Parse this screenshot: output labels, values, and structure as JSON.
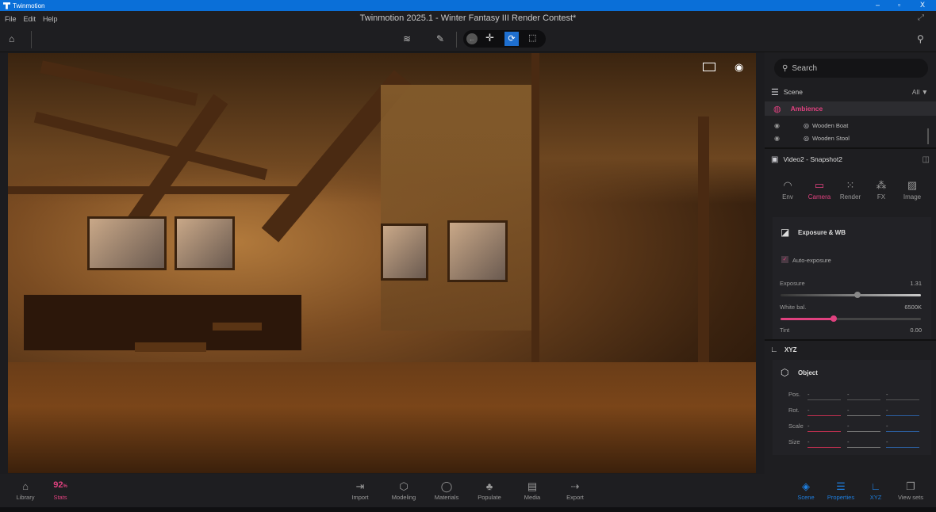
{
  "window": {
    "app_name": "Twinmotion",
    "title": "Twinmotion 2025.1 - Winter Fantasy III Render Contest*",
    "minimize": "–",
    "restore": "▫",
    "close": "X"
  },
  "menu": [
    "File",
    "Edit",
    "Help"
  ],
  "panel": {
    "search_placeholder": "Search",
    "scene_label": "Scene",
    "filter": "All",
    "ambience": "Ambience",
    "items": [
      "Wooden Boat",
      "Wooden Stool"
    ],
    "snapshot": "Video2 - Snapshot2",
    "tabs": [
      "Env",
      "Camera",
      "Render",
      "FX",
      "Image"
    ],
    "active_tab": "Camera",
    "exposure_section": "Exposure & WB",
    "auto_exposure": "Auto-exposure",
    "auto_exposure_checked": true,
    "exposure": {
      "label": "Exposure",
      "value": "1.31",
      "fraction": 0.55
    },
    "white_balance": {
      "label": "White bal.",
      "value": "6500K",
      "fraction": 0.38
    },
    "tint": {
      "label": "Tint",
      "value": "0.00"
    },
    "xyz_label": "XYZ",
    "object_label": "Object",
    "xyz_rows": [
      "Pos.",
      "Rot.",
      "Scale",
      "Size"
    ],
    "xyz_placeholder": "-"
  },
  "bottom": {
    "left": [
      {
        "label": "Library"
      },
      {
        "label": "Stats",
        "value": "92",
        "unit": "%"
      }
    ],
    "center": [
      "Import",
      "Modeling",
      "Materials",
      "Populate",
      "Media",
      "Export"
    ],
    "right": [
      "Scene",
      "Properties",
      "XYZ",
      "View sets"
    ]
  },
  "colors": {
    "accent": "#e0417f",
    "active_blue": "#1e7fe0",
    "titlebar": "#0a6fd8"
  }
}
